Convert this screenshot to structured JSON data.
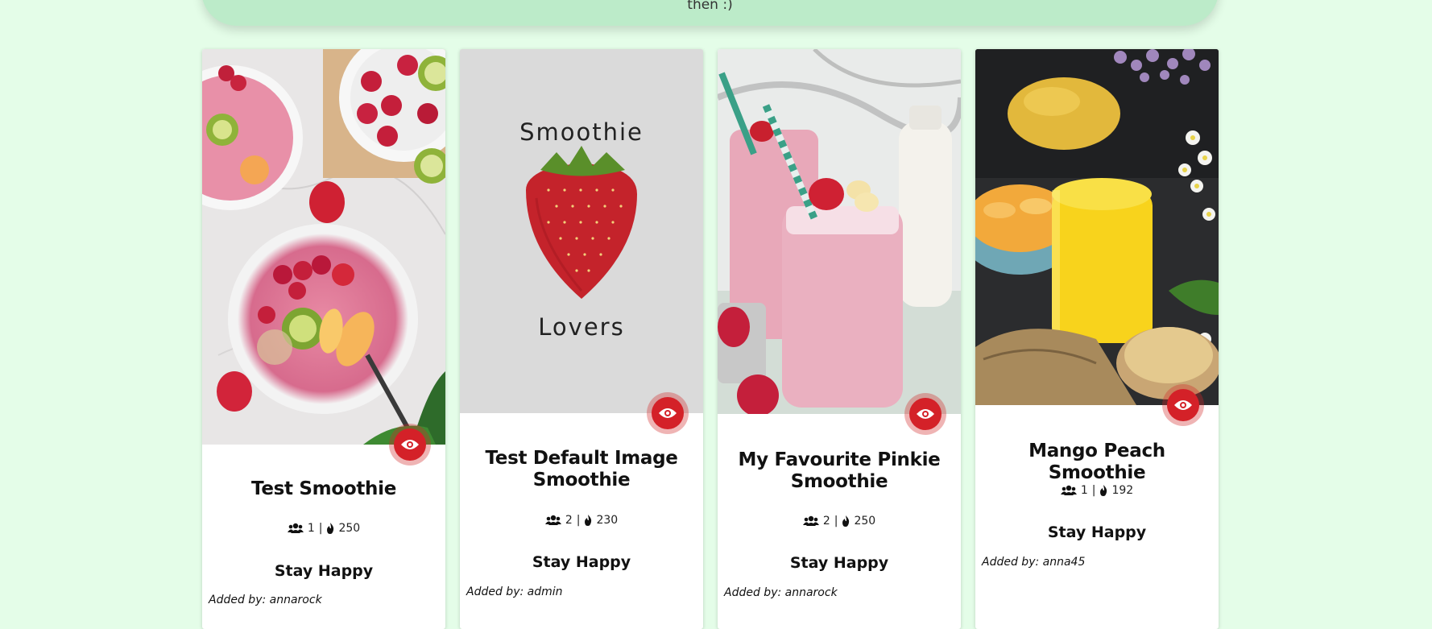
{
  "banner": {
    "text": "then :)"
  },
  "cards": [
    {
      "title": "Test Smoothie",
      "servings": "1",
      "separator": "|",
      "calories": "250",
      "tagline": "Stay Happy",
      "author_label": "Added by: annarock",
      "image": "smoothie-bowls-photo"
    },
    {
      "title": "Test Default Image Smoothie",
      "servings": "2",
      "separator": "|",
      "calories": "230",
      "tagline": "Stay Happy",
      "author_label": "Added by: admin",
      "image": "default-image",
      "default_image_text_top": "Smoothie",
      "default_image_text_bottom": "Lovers"
    },
    {
      "title": "My Favourite Pinkie Smoothie",
      "servings": "2",
      "separator": "|",
      "calories": "250",
      "tagline": "Stay Happy",
      "author_label": "Added by: annarock",
      "image": "pink-smoothie-jar-photo"
    },
    {
      "title": "Mango Peach Smoothie",
      "servings": "1",
      "separator": "|",
      "calories": "192",
      "tagline": "Stay Happy",
      "author_label": "Added by: anna45",
      "image": "mango-peach-smoothie-photo"
    }
  ],
  "icons": {
    "view": "eye-icon",
    "servings": "users-icon",
    "calories": "fire-icon"
  },
  "colors": {
    "page_background": "#e4fde8",
    "banner_background": "#bcebc9",
    "accent_red": "#d42128"
  }
}
